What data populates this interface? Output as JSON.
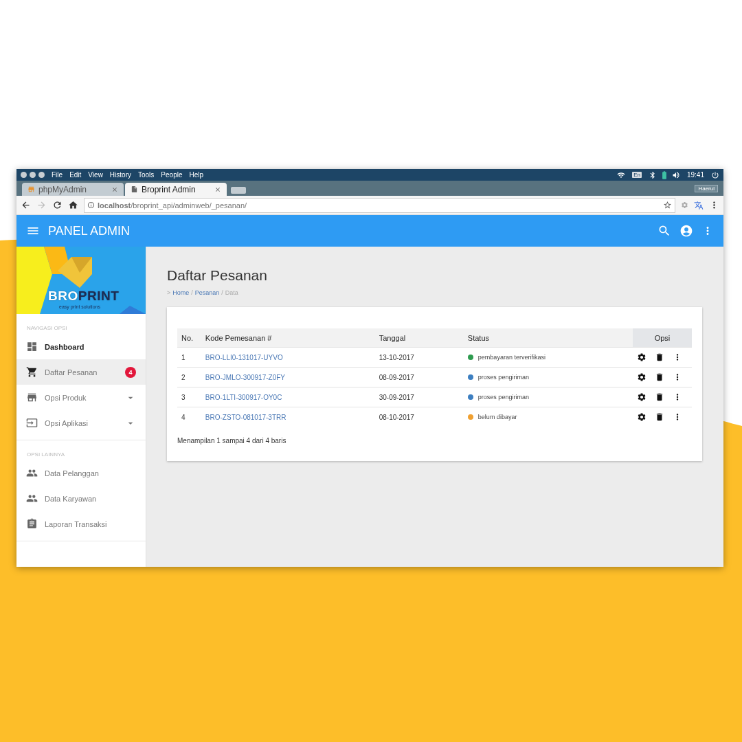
{
  "os_bar": {
    "menus": [
      "File",
      "Edit",
      "View",
      "History",
      "Tools",
      "People",
      "Help"
    ],
    "keyboard_layout": "En",
    "time": "19:41"
  },
  "browser": {
    "tabs": [
      {
        "label": "phpMyAdmin",
        "selected": false
      },
      {
        "label": "Broprint Admin",
        "selected": true
      }
    ],
    "profile": "Haerul",
    "url": "**localhost**/broprint_api/adminweb/_pesanan/"
  },
  "app_bar": {
    "title": "PANEL ADMIN"
  },
  "sidebar": {
    "logo": {
      "brand_parts": [
        "BRO",
        "PRINT"
      ],
      "tagline": "easy print solutions"
    },
    "sections": [
      {
        "heading": "NAVIGASI OPSI",
        "items": [
          {
            "label": "Dashboard",
            "kind": "link",
            "selected": false,
            "emphasized": true
          },
          {
            "label": "Daftar Pesanan",
            "kind": "link",
            "selected": true,
            "emphasized": false,
            "badge": "4"
          },
          {
            "label": "Opsi Produk",
            "kind": "dropdown",
            "selected": false,
            "emphasized": false,
            "expanded": false
          },
          {
            "label": "Opsi Aplikasi",
            "kind": "dropdown",
            "selected": false,
            "emphasized": false,
            "expanded": false
          }
        ]
      },
      {
        "heading": "OPSI LAINNYA",
        "items": [
          {
            "label": "Data Pelanggan",
            "kind": "link",
            "selected": false,
            "emphasized": false
          },
          {
            "label": "Data Karyawan",
            "kind": "link",
            "selected": false,
            "emphasized": false
          },
          {
            "label": "Laporan Transaksi",
            "kind": "link",
            "selected": false,
            "emphasized": false
          }
        ]
      }
    ]
  },
  "page": {
    "title": "Daftar Pesanan",
    "breadcrumb": {
      "prefix": ">",
      "links": [
        "Home",
        "Pesanan"
      ],
      "separator": "/",
      "current": "Data"
    }
  },
  "table": {
    "columns": [
      "No.",
      "Kode Pemesanan #",
      "Tanggal",
      "Status",
      "Opsi"
    ],
    "rows": [
      {
        "no": "1",
        "code": "BRO-LLI0-131017-UYVO",
        "date": "13-10-2017",
        "status": "pembayaran terverifikasi",
        "color": "#2e9b4f"
      },
      {
        "no": "2",
        "code": "BRO-JMLO-300917-Z0FY",
        "date": "08-09-2017",
        "status": "proses pengiriman",
        "color": "#3d7fc1"
      },
      {
        "no": "3",
        "code": "BRO-1LTI-300917-OY0C",
        "date": "30-09-2017",
        "status": "proses pengiriman",
        "color": "#3d7fc1"
      },
      {
        "no": "4",
        "code": "BRO-ZSTO-081017-3TRR",
        "date": "08-10-2017",
        "status": "belum dibayar",
        "color": "#f0a030"
      }
    ],
    "footer": "Menampilan 1 sampai 4 dari 4 baris"
  }
}
